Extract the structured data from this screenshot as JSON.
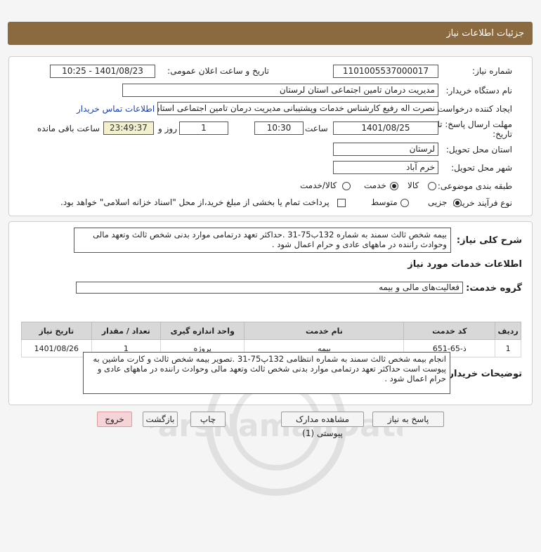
{
  "page": {
    "title": "جزئیات اطلاعات نیاز"
  },
  "form": {
    "need_number_label": "شماره نیاز:",
    "need_number": "1101005537000017",
    "announce_label": "تاریخ و ساعت اعلان عمومی:",
    "announce_value": "1401/08/23 - 10:25",
    "buyer_label": "نام دستگاه خریدار:",
    "buyer_value": "مدیریت درمان تامین اجتماعی استان لرستان",
    "creator_label": "ایجاد کننده درخواست:",
    "creator_value": "نصرت اله رفیع کارشناس خدمات وپشتیبانی مدیریت درمان تامین اجتماعی استان لرستان",
    "contact_link": "اطلاعات تماس خریدار",
    "deadline_label_1": "مهلت ارسال پاسخ: تا",
    "deadline_label_2": "تاریخ:",
    "deadline_date": "1401/08/25",
    "time_label": "ساعت",
    "deadline_time": "10:30",
    "days_value": "1",
    "days_label": "روز و",
    "remaining_time": "23:49:37",
    "remaining_label": "ساعت باقی مانده",
    "province_label": "استان محل تحویل:",
    "province_value": "لرستان",
    "city_label": "شهر محل تحویل:",
    "city_value": "خرم آباد",
    "category_label": "طبقه بندی موضوعی:",
    "category_options": [
      "کالا",
      "خدمت",
      "کالا/خدمت"
    ],
    "category_selected": "خدمت",
    "process_label": "نوع فرآیند خرید :",
    "process_options": [
      "جزیی",
      "متوسط"
    ],
    "process_selected": "جزیی",
    "payment_text": "پرداخت تمام یا بخشی از مبلغ خرید،از محل \"اسناد خزانه اسلامی\" خواهد بود."
  },
  "details": {
    "general_desc_label": "شرح کلی نیاز:",
    "general_desc": "بیمه شخص ثالث سمند  به شماره  132ب75-31 .حداکثر تعهد درتمامی موارد  بدنی شخص ثالث وتعهد مالی وحوادث راننده در ماههای عادی و حرام اعمال شود .",
    "services_heading": "اطلاعات خدمات مورد نیاز",
    "service_group_label": "گروه خدمت:",
    "service_group_value": "فعالیت‌های مالی و بیمه",
    "table": {
      "headers": [
        "ردیف",
        "کد خدمت",
        "نام خدمت",
        "واحد اندازه گیری",
        "تعداد / مقدار",
        "تاریخ نیاز"
      ],
      "rows": [
        [
          "1",
          "ذ-65-651",
          "بیمه",
          "پروژه",
          "1",
          "1401/08/26"
        ]
      ]
    },
    "buyer_notes_label": "توضیحات خریدار:",
    "buyer_notes": "انجام بیمه شخص ثالث سمند  به شماره انتظامی 132پ75-31 .تصویر بیمه شخص ثالث  و  کارت ماشین به پیوست است حداکثر تعهد درتمامی موارد  بدنی شخص ثالث وتعهد مالی وحوادث راننده در ماههای عادی و حرام اعمال شود ."
  },
  "buttons": {
    "reply": "پاسخ به نیاز",
    "attachments": "مشاهده مدارک پیوستی (1)",
    "print": "چاپ",
    "back": "بازگشت",
    "exit": "خروج"
  },
  "watermark": {
    "text": "ParsNamadData"
  },
  "colors": {
    "title_bar": "#8c6a3f",
    "link": "#1a3fb5",
    "remaining_bg": "#f3f0cf",
    "exit_bg": "#f6d3d6"
  }
}
